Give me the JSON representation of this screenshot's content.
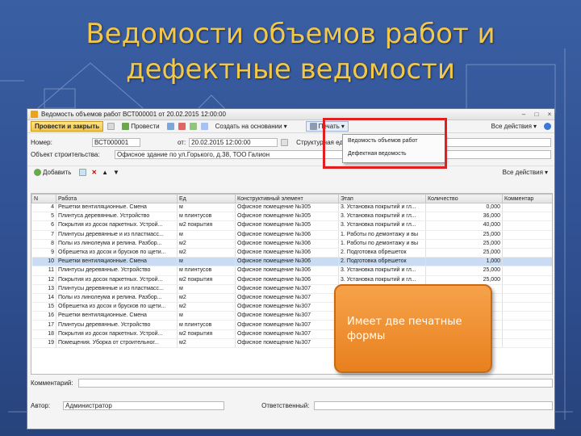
{
  "slide": {
    "title_line1": "Ведомости объемов работ и",
    "title_line2": "дефектные ведомости",
    "colors": {
      "title": "#f2c84b",
      "background": "#2f4f90",
      "callout": "#e8801e",
      "highlight": "#e02020"
    }
  },
  "window": {
    "title": "Ведомость объемов работ ВСТ000001 от 20.02.2015 12:00:00",
    "toolbar": {
      "post_close": "Провести и закрыть",
      "post": "Провести",
      "create_based": "Создать на основании",
      "print": "Печать",
      "all_actions": "Все действия"
    },
    "print_menu": [
      "Ведомость объемов работ",
      "Дефектная ведомость"
    ],
    "form": {
      "number_label": "Номер:",
      "number_value": "ВСТ000001",
      "date_label": "от:",
      "date_value": "20.02.2015 12:00:00",
      "struct_label": "Структурная ед",
      "object_label": "Объект строительства:",
      "object_value": "Офисное здание по ул.Горького, д.38, ТОО Галион"
    },
    "subtoolbar": {
      "add": "Добавить",
      "all_actions": "Все действия"
    },
    "columns": [
      "N",
      "Работа",
      "Ед",
      "Конструктивный элемент",
      "Этап",
      "Количество",
      "Комментар"
    ],
    "rows": [
      {
        "n": "4",
        "work": "Решетки вентиляционные. Смена",
        "unit": "м",
        "elem": "Офисное помещение №305",
        "stage": "3. Установка покрытий и гл...",
        "qty": "0,000"
      },
      {
        "n": "5",
        "work": "Плинтуса деревянные. Устройство",
        "unit": "м плинтусов",
        "elem": "Офисное помещение №305",
        "stage": "3. Установка покрытий и гл...",
        "qty": "36,000"
      },
      {
        "n": "6",
        "work": "Покрытия из досок паркетных. Устрой...",
        "unit": "м2 покрытия",
        "elem": "Офисное помещение №305",
        "stage": "3. Установка покрытий и гл...",
        "qty": "40,000"
      },
      {
        "n": "7",
        "work": "Плинтусы деревянные и из пластмасс...",
        "unit": "м",
        "elem": "Офисное помещение №306",
        "stage": "1. Работы по демонтажу и вы",
        "qty": "25,000"
      },
      {
        "n": "8",
        "work": "Полы из линолеума и релина. Разбор...",
        "unit": "м2",
        "elem": "Офисное помещение №306",
        "stage": "1. Работы по демонтажу и вы",
        "qty": "25,000"
      },
      {
        "n": "9",
        "work": "Обрешетка из досок и брусков по щети...",
        "unit": "м2",
        "elem": "Офисное помещение №306",
        "stage": "2. Подготовка обрешеток",
        "qty": "25,000"
      },
      {
        "n": "10",
        "work": "Решетки вентиляционные. Смена",
        "unit": "м",
        "elem": "Офисное помещение №306",
        "stage": "2. Подготовка обрешеток",
        "qty": "1,000"
      },
      {
        "n": "11",
        "work": "Плинтусы деревянные. Устройство",
        "unit": "м плинтусов",
        "elem": "Офисное помещение №306",
        "stage": "3. Установка покрытий и гл...",
        "qty": "25,000"
      },
      {
        "n": "12",
        "work": "Покрытия из досок паркетных. Устрой...",
        "unit": "м2 покрытия",
        "elem": "Офисное помещение №306",
        "stage": "3. Установка покрытий и гл...",
        "qty": "25,000"
      },
      {
        "n": "13",
        "work": "Плинтусы деревянные и из пластмасс...",
        "unit": "м",
        "elem": "Офисное помещение №307",
        "stage": "1. Работы по демонтажу и вы",
        "qty": ""
      },
      {
        "n": "14",
        "work": "Полы из линолеума и релина. Разбор...",
        "unit": "м2",
        "elem": "Офисное помещение №307",
        "stage": "1. Работы по демонтажу и вы",
        "qty": ""
      },
      {
        "n": "15",
        "work": "Обрешетка из досок и брусков по щети...",
        "unit": "м2",
        "elem": "Офисное помещение №307",
        "stage": "2. Подготовка обрешеток",
        "qty": ""
      },
      {
        "n": "16",
        "work": "Решетки вентиляционные. Смена",
        "unit": "м",
        "elem": "Офисное помещение №307",
        "stage": "2. Подготовка обрешеток",
        "qty": ""
      },
      {
        "n": "17",
        "work": "Плинтусы деревянные. Устройство",
        "unit": "м плинтусов",
        "elem": "Офисное помещение №307",
        "stage": "3. Установка покрытий и гл...",
        "qty": ""
      },
      {
        "n": "18",
        "work": "Покрытия из досок паркетных. Устрой...",
        "unit": "м2 покрытия",
        "elem": "Офисное помещение №307",
        "stage": "3. Установка покрытий и гл...",
        "qty": ""
      },
      {
        "n": "19",
        "work": "Помещения. Уборка от строительног...",
        "unit": "м2",
        "elem": "Офисное помещение №307",
        "stage": "",
        "qty": ""
      }
    ],
    "selected_row_index": 6,
    "comment_label": "Комментарий:",
    "author_label": "Автор:",
    "author_value": "Администратор",
    "responsible_label": "Ответственный:"
  },
  "callout": {
    "text": "Имеет две печатные формы"
  }
}
